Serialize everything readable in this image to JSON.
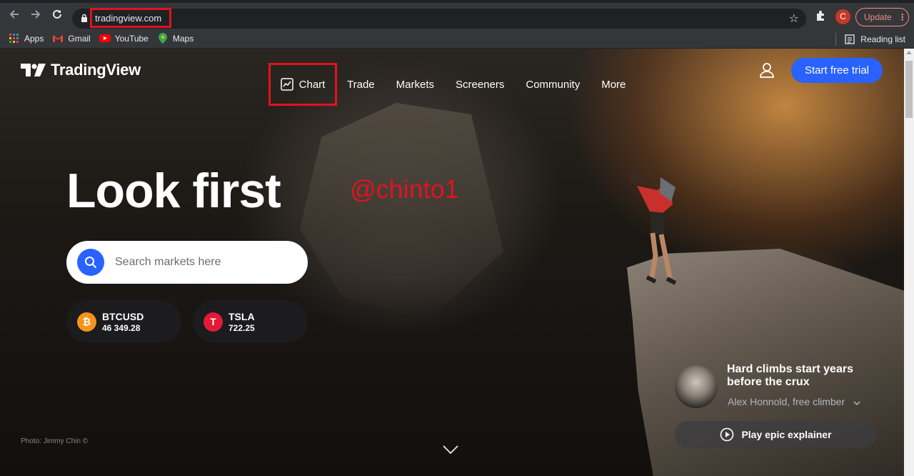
{
  "browser": {
    "url": "tradingview.com",
    "profile_initial": "C",
    "update_label": "Update",
    "bookmarks": [
      {
        "label": "Apps",
        "icon": "apps-grid-icon"
      },
      {
        "label": "Gmail",
        "icon": "gmail-icon"
      },
      {
        "label": "YouTube",
        "icon": "youtube-icon"
      },
      {
        "label": "Maps",
        "icon": "maps-icon"
      }
    ],
    "reading_list": "Reading list"
  },
  "header": {
    "logo": "TradingView",
    "nav": [
      {
        "label": "Chart",
        "icon": "chart-line-icon"
      },
      {
        "label": "Trade"
      },
      {
        "label": "Markets"
      },
      {
        "label": "Screeners"
      },
      {
        "label": "Community"
      },
      {
        "label": "More"
      }
    ],
    "cta": "Start free trial",
    "user_icon": "user-icon"
  },
  "hero": {
    "headline": "Look first",
    "watermark": "@chinto1",
    "search_placeholder": "Search markets here",
    "tickers": [
      {
        "symbol": "BTCUSD",
        "price": "46 349.28",
        "badge": "₿",
        "color": "#f7931a"
      },
      {
        "symbol": "TSLA",
        "price": "722.25",
        "badge": "T",
        "color": "#e31937"
      }
    ],
    "photo_credit": "Photo: Jimmy Chin ©"
  },
  "story": {
    "title": "Hard climbs start years before the crux",
    "subtitle": "Alex Honnold, free climber",
    "play_label": "Play epic explainer"
  },
  "colors": {
    "accent": "#2962ff",
    "highlight": "#e0131e"
  }
}
